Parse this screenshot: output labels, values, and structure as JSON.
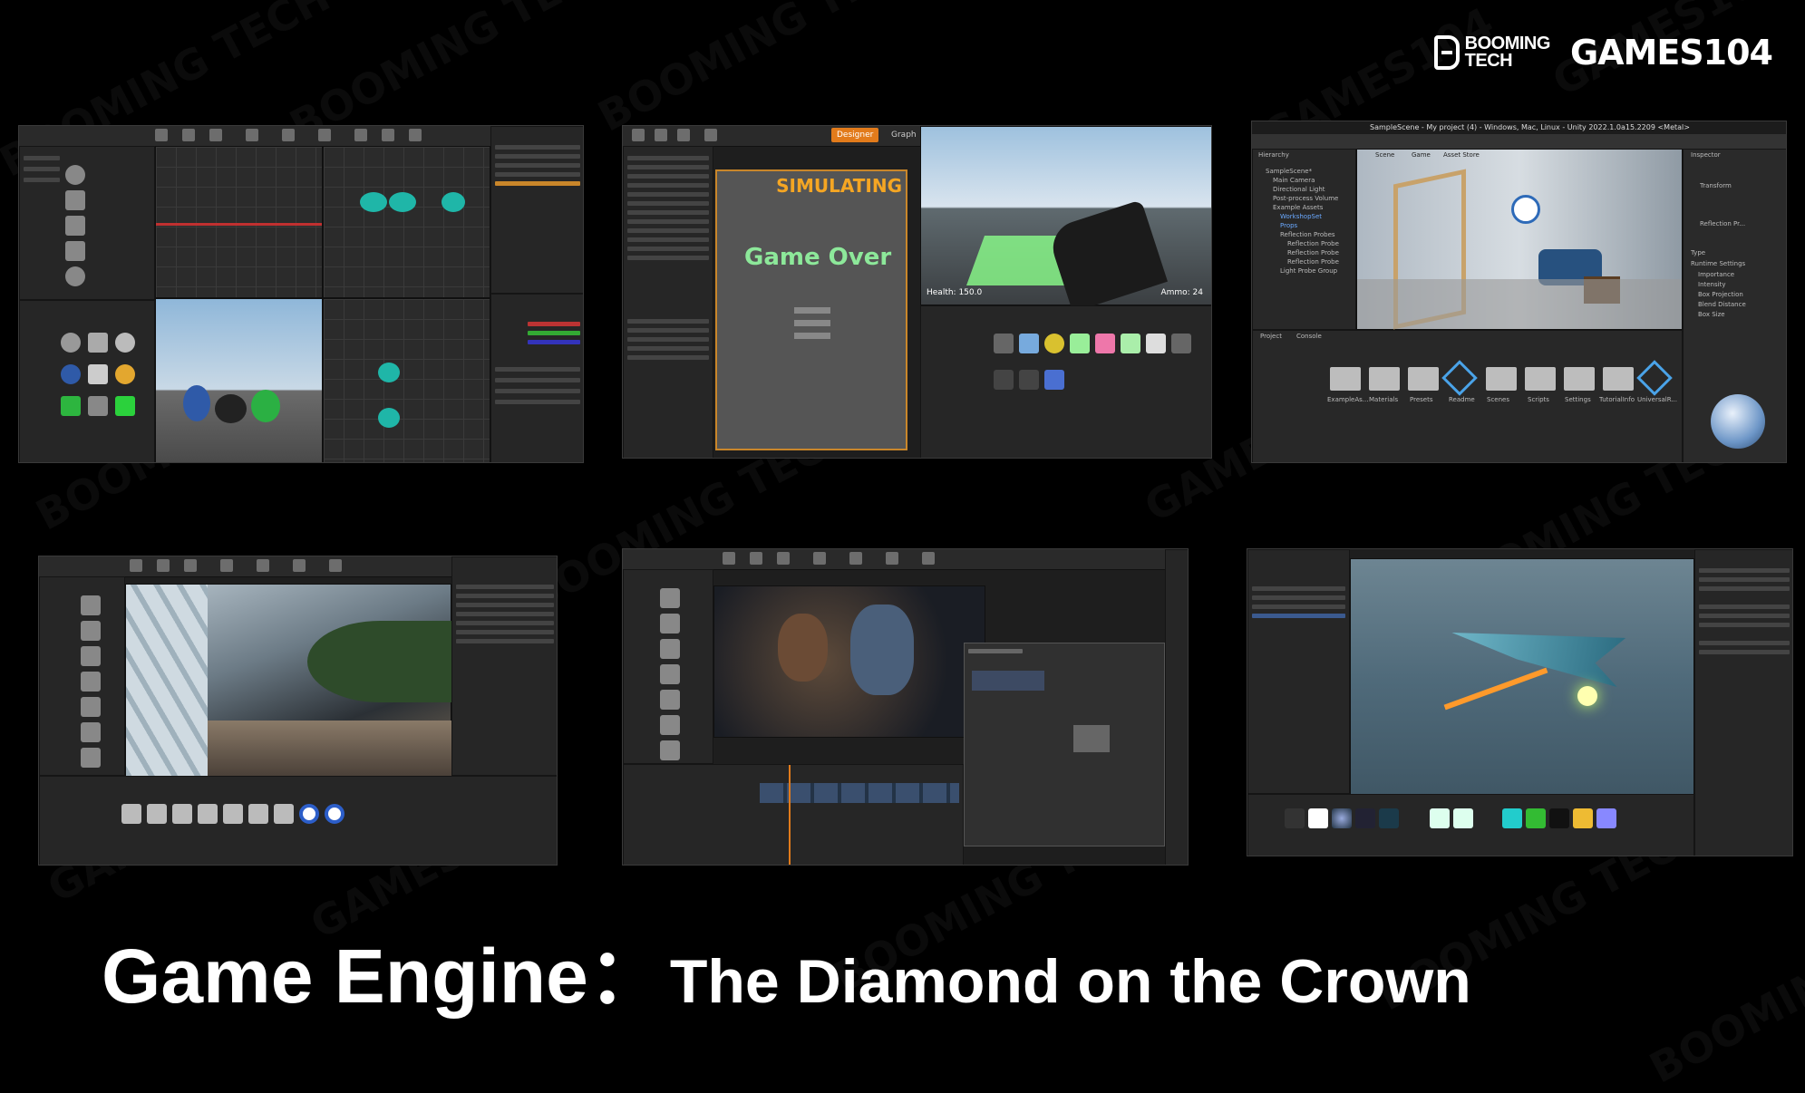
{
  "brand": {
    "booming_line1": "BOOMING",
    "booming_line2": "TECH",
    "games": "GAMES104"
  },
  "title": {
    "main": "Game Engine：",
    "sub": "The Diamond on the Crown"
  },
  "screenshots": {
    "ue_blueprint": {
      "overlay": "SIMULATING",
      "game_text": "Game Over",
      "health": "Health: 150.0",
      "ammo": "Ammo: 24",
      "tabs": [
        "Designer",
        "Graph"
      ]
    },
    "unity": {
      "window_title": "SampleScene - My project (4) - Windows, Mac, Linux - Unity 2022.1.0a15.2209 <Metal>",
      "panels": [
        "Hierarchy",
        "Scene",
        "Game",
        "Asset Store",
        "Inspector",
        "Project",
        "Console"
      ],
      "hierarchy": [
        "SampleScene*",
        "Main Camera",
        "Directional Light",
        "Post-process Volume",
        "Example Assets",
        "WorkshopSet",
        "Props",
        "Reflection Probes",
        "Reflection Probe",
        "Reflection Probe",
        "Reflection Probe",
        "Light Probe Group"
      ],
      "folders": [
        "ExampleAs...",
        "Materials",
        "Presets",
        "Readme",
        "Scenes",
        "Scripts",
        "Settings",
        "TutorialInfo",
        "UniversalR..."
      ],
      "inspector": [
        "Transform",
        "Reflection Pr...",
        "Type",
        "Runtime Settings",
        "Importance",
        "Intensity",
        "Box Projection",
        "Blend Distance",
        "Box Size"
      ]
    }
  },
  "colors": {
    "accent_orange": "#f5a623",
    "game_green": "#8de89a"
  }
}
